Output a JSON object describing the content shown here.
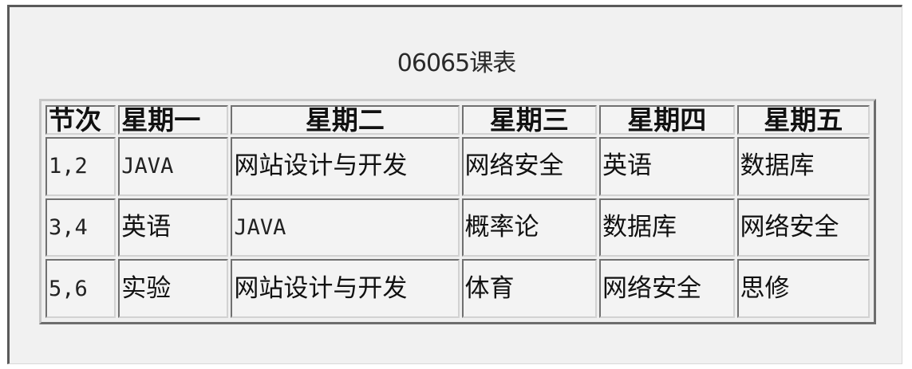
{
  "caption": "06065课表",
  "table": {
    "headers": [
      "节次",
      "星期一",
      "星期二",
      "星期三",
      "星期四",
      "星期五"
    ],
    "rows": [
      [
        "1,2",
        "JAVA",
        "网站设计与开发",
        "网络安全",
        "英语",
        "数据库"
      ],
      [
        "3,4",
        "英语",
        "JAVA",
        "概率论",
        "数据库",
        "网络安全"
      ],
      [
        "5,6",
        "实验",
        "网站设计与开发",
        "体育",
        "网络安全",
        "思修"
      ]
    ]
  }
}
